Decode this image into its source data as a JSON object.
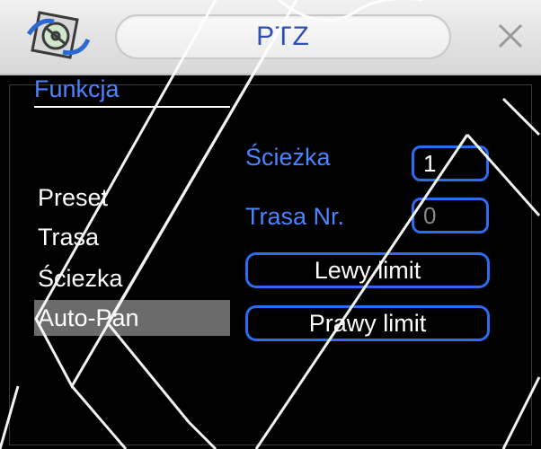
{
  "window": {
    "title": "PTZ"
  },
  "menu": {
    "header": "Funkcja",
    "items": [
      {
        "label": "Preset",
        "selected": false
      },
      {
        "label": "Trasa",
        "selected": false
      },
      {
        "label": "Ściezka",
        "selected": false
      },
      {
        "label": "Auto-Pan",
        "selected": true
      }
    ]
  },
  "fields": {
    "sciezka_label": "Ścieżka",
    "sciezka_value": "1",
    "trasa_label": "Trasa Nr.",
    "trasa_value": "0"
  },
  "buttons": {
    "left_limit": "Lewy limit",
    "right_limit": "Prawy limit"
  },
  "colors": {
    "accent": "#4c83ff",
    "border": "#2d6cf0",
    "selected_bg": "#6b6b6b"
  },
  "icons": {
    "app": "reel-icon",
    "close": "close-icon"
  }
}
